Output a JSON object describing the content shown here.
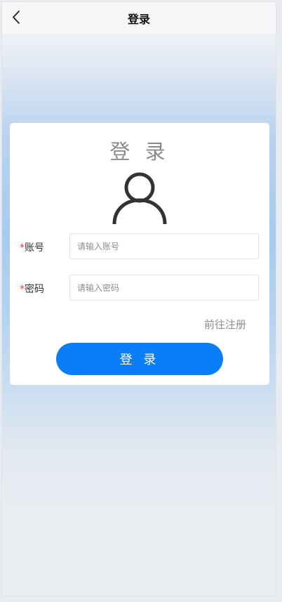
{
  "navbar": {
    "title": "登录",
    "back_icon": "chevron-left-icon"
  },
  "login_card": {
    "title": "登 录",
    "avatar_icon": "user-avatar-icon",
    "account": {
      "required_mark": "*",
      "label": "账号",
      "placeholder": "请输入账号",
      "value": ""
    },
    "password": {
      "required_mark": "*",
      "label": "密码",
      "placeholder": "请输入密码",
      "value": ""
    },
    "register_link": "前往注册",
    "login_button": "登 录"
  },
  "colors": {
    "accent": "#0a7ef9",
    "required": "#e43b3b",
    "gradient_mid": "#a6cbf1"
  }
}
